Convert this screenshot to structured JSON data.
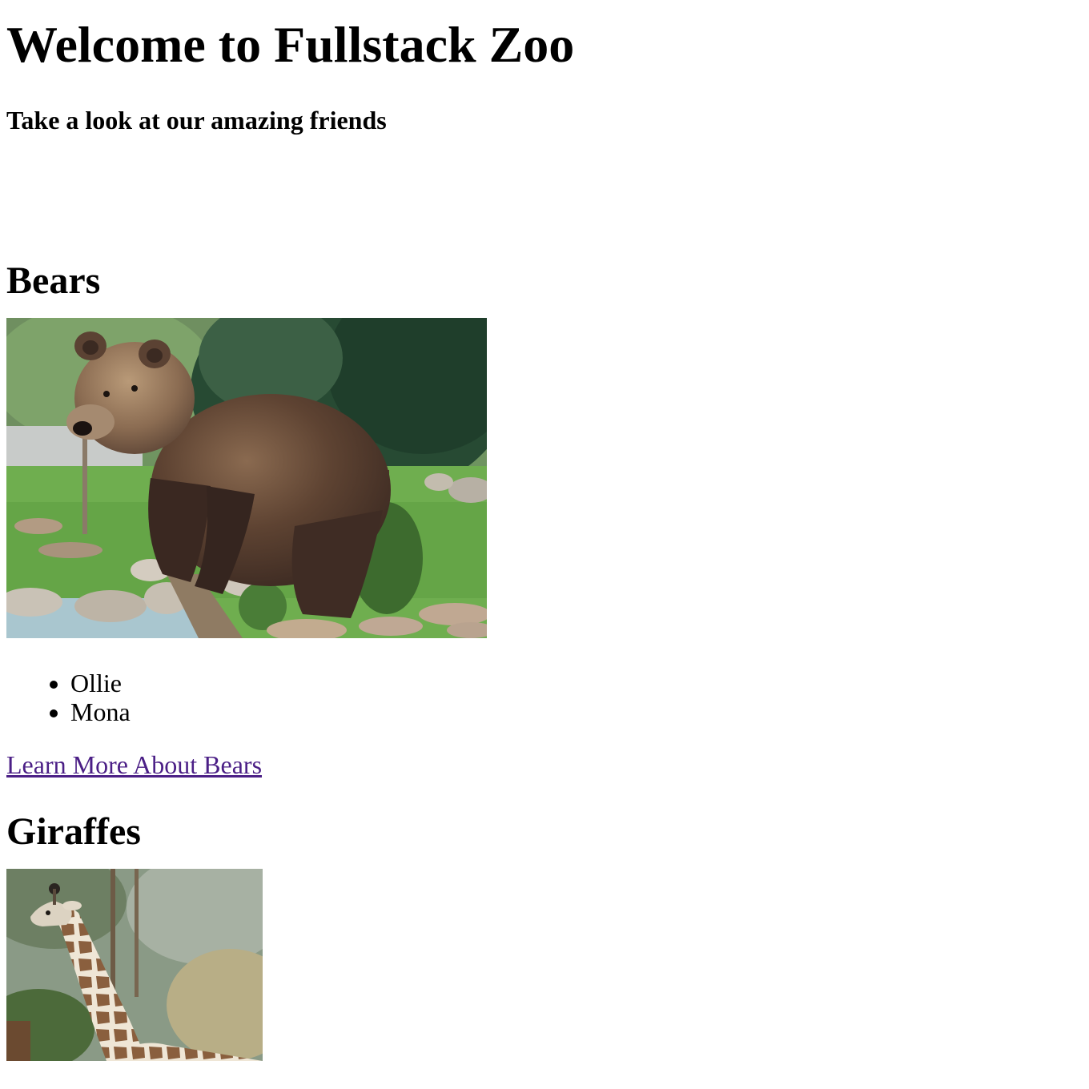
{
  "header": {
    "title": "Welcome to Fullstack Zoo",
    "subtitle": "Take a look at our amazing friends"
  },
  "sections": [
    {
      "heading": "Bears",
      "image": "bear-photo",
      "animals": [
        "Ollie",
        "Mona"
      ],
      "link_label": "Learn More About Bears"
    },
    {
      "heading": "Giraffes",
      "image": "giraffe-photo"
    }
  ],
  "colors": {
    "link_visited": "#4b1f86",
    "text": "#000000",
    "background": "#ffffff"
  }
}
